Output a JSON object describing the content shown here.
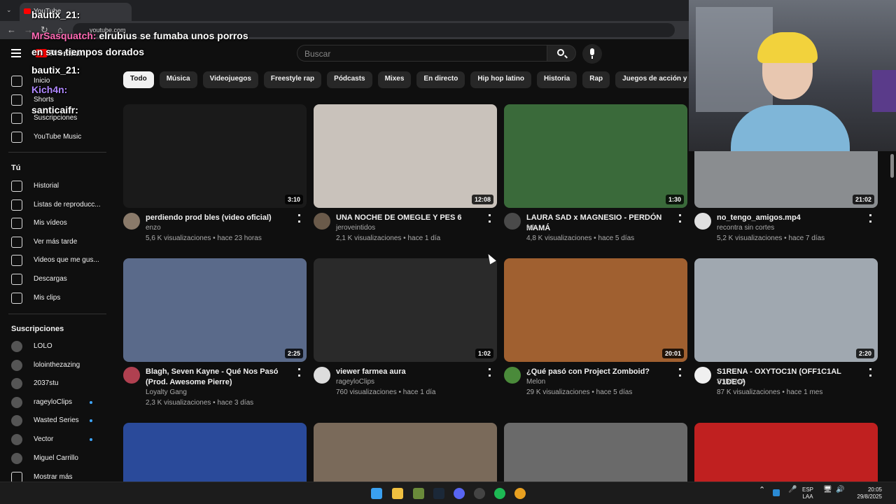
{
  "browser": {
    "tab_title": "YouTube",
    "url": "youtube.com",
    "tab_menu": "⌄"
  },
  "masthead": {
    "logo_text": "Premium",
    "search_placeholder": "Buscar"
  },
  "chips": [
    "Todo",
    "Música",
    "Videojuegos",
    "Freestyle rap",
    "Pódcasts",
    "Mixes",
    "En directo",
    "Hip hop latino",
    "Historia",
    "Rap",
    "Juegos de acción y aventuras",
    "Música el"
  ],
  "sidebar": {
    "main": [
      "Inicio",
      "Shorts",
      "Suscripciones",
      "YouTube Music"
    ],
    "you_header": "Tú",
    "you": [
      "Historial",
      "Listas de reproducc...",
      "Mis vídeos",
      "Ver más tarde",
      "Videos que me gus...",
      "Descargas",
      "Mis clips"
    ],
    "subs_header": "Suscripciones",
    "subs": [
      {
        "name": "LOLO",
        "dot": false
      },
      {
        "name": "lolointhezazing",
        "dot": false
      },
      {
        "name": "2037stu",
        "dot": false
      },
      {
        "name": "rageyloClips",
        "dot": true
      },
      {
        "name": "Wasted Series",
        "dot": true
      },
      {
        "name": "Vector",
        "dot": true
      },
      {
        "name": "Miguel Carrillo",
        "dot": false
      }
    ],
    "show_more": "Mostrar más"
  },
  "videos": [
    {
      "title": "perdiendo prod bles (video oficial)",
      "channel": "enzo",
      "meta": "5,6 K visualizaciones • hace 23 horas",
      "duration": "3:10",
      "thumb": "#1a1a1a",
      "avatar": "#8a7a6a"
    },
    {
      "title": "UNA NOCHE DE OMEGLE Y PES 6",
      "channel": "jeroveintidos",
      "meta": "2,1 K visualizaciones • hace 1 día",
      "duration": "12:08",
      "thumb": "#c9c2bb",
      "avatar": "#6a5a4a"
    },
    {
      "title": "LAURA SAD x MAGNESIO - PERDÓN MAMÁ",
      "channel": "felx",
      "meta": "4,8 K visualizaciones • hace 5 días",
      "duration": "1:30",
      "thumb": "#3a6a3a",
      "avatar": "#4a4a4a"
    },
    {
      "title": "no_tengo_amigos.mp4",
      "channel": "recontra sin cortes",
      "meta": "5,2 K visualizaciones • hace 7 días",
      "duration": "21:02",
      "thumb": "#8a8d90",
      "avatar": "#e0e0e0"
    },
    {
      "title": "Blagh, Seven Kayne - Qué Nos Pasó (Prod. Awesome Pierre)",
      "channel": "Loyalty Gang",
      "meta": "2,3 K visualizaciones • hace 3 días",
      "duration": "2:25",
      "thumb": "#5a6a8a",
      "avatar": "#b04050"
    },
    {
      "title": "viewer farmea aura",
      "channel": "rageyloClips",
      "meta": "760 visualizaciones • hace 1 día",
      "duration": "1:02",
      "thumb": "#2a2a2a",
      "avatar": "#dddddd"
    },
    {
      "title": "¿Qué pasó con Project Zomboid?",
      "channel": "Melon",
      "meta": "29 K visualizaciones • hace 5 días",
      "duration": "20:01",
      "thumb": "#a06030",
      "avatar": "#4a8a3a"
    },
    {
      "title": "S1RENA - OXYTOC1N  (OFF1C1AL V1DEO)",
      "channel": "S1RENA",
      "meta": "87 K visualizaciones • hace 1 mes",
      "duration": "2:20",
      "thumb": "#a0a8b0",
      "avatar": "#f0f0f0"
    },
    {
      "title": "",
      "channel": "",
      "meta": "",
      "duration": "",
      "thumb": "#2a4a9a",
      "avatar": ""
    },
    {
      "title": "",
      "channel": "",
      "meta": "",
      "duration": "",
      "thumb": "#7a6a5a",
      "avatar": ""
    },
    {
      "title": "",
      "channel": "",
      "meta": "",
      "duration": "",
      "thumb": "#6a6a6a",
      "avatar": ""
    },
    {
      "title": "",
      "channel": "",
      "meta": "",
      "duration": "",
      "thumb": "#c02020",
      "avatar": ""
    }
  ],
  "chat": [
    {
      "user": "bautix_21:",
      "color": "#ffffff",
      "msg": ""
    },
    {
      "user": "MrSasquatch:",
      "color": "#ff69b4",
      "msg": " elrubius se fumaba unos porros"
    },
    {
      "user": "",
      "color": "#ffffff",
      "msg": "en sus tiempos dorados"
    },
    {
      "user": "bautix_21:",
      "color": "#ffffff",
      "msg": ""
    },
    {
      "user": "Kich4n:",
      "color": "#b088ff",
      "msg": ""
    },
    {
      "user": "santicaifr:",
      "color": "#ffffff",
      "msg": ""
    }
  ],
  "tray": {
    "lang1": "ESP",
    "lang2": "LAA",
    "time": "20:05",
    "date": "29/8/2025"
  }
}
